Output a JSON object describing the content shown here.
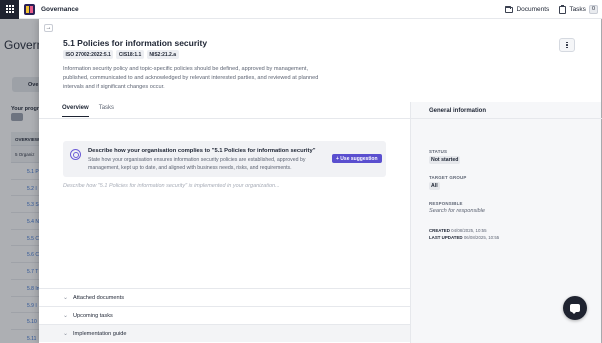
{
  "topbar": {
    "app_title": "Governance",
    "documents_label": "Documents",
    "tasks_label": "Tasks",
    "tasks_count": "0"
  },
  "background": {
    "title": "Govern",
    "tab": "Ove",
    "progress_label": "Your progr",
    "table_header": "OVERVIEW",
    "org_row": "5 Organiz",
    "rows": [
      "5.1 P",
      "5.2 I",
      "5.3 S",
      "5.4 N",
      "5.5 C",
      "5.6 C",
      "5.7 T",
      "5.8 In",
      "5.9 I",
      "5.10",
      "5.11"
    ]
  },
  "policy": {
    "title": "5.1 Policies for information security",
    "tags": [
      "ISO 27002:2022:5.1",
      "CIS18:1.1",
      "NIS2:21.2.a"
    ],
    "description": "Information security policy and topic-specific policies should be defined, approved by management, published, communicated to and acknowledged by relevant interested parties, and reviewed at planned intervals and if significant changes occur."
  },
  "tabs": {
    "overview": "Overview",
    "tasks": "Tasks"
  },
  "suggestion": {
    "title": "Describe how your organisation complies to \"5.1 Policies for information security\"",
    "body": "State how your organisation ensures information security policies are established, approved by management, kept up to date, and aligned with business needs, risks, and requirements.",
    "button_label": "+ Use suggestion"
  },
  "implementation": {
    "placeholder": "Describe how \"5.1 Policies for information security\" is implemented in your organization..."
  },
  "accordions": {
    "attached": "Attached documents",
    "upcoming": "Upcoming tasks",
    "guide": "Implementation guide"
  },
  "general": {
    "title": "General information",
    "status_label": "STATUS",
    "status_value": "Not started",
    "target_label": "TARGET GROUP",
    "target_value": "All",
    "responsible_label": "RESPONSIBLE",
    "responsible_value": "Search for responsible",
    "created_label": "CREATED",
    "created_value": "04/08/2025, 10:55",
    "updated_label": "LAST UPDATED",
    "updated_value": "06/08/2025, 10:55"
  },
  "colors": {
    "accent": "#5a4fcf",
    "dark": "#1f2330"
  }
}
